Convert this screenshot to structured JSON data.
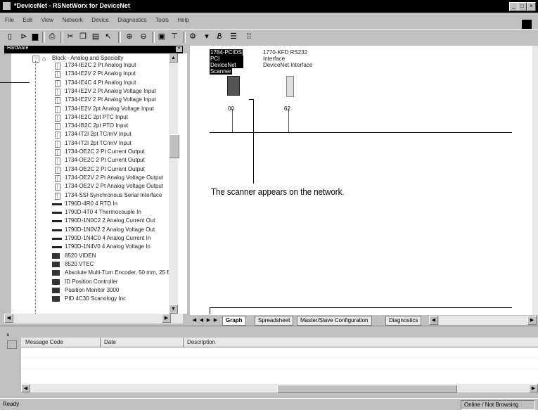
{
  "window": {
    "title": "*DeviceNet - RSNetWorx for DeviceNet"
  },
  "menu": {
    "items": [
      "File",
      "Edit",
      "View",
      "Network",
      "Device",
      "Diagnostics",
      "Tools",
      "Help"
    ]
  },
  "tree": {
    "header": "Hardware",
    "category": "Block - Analog and Specialty",
    "items": [
      "1734-IE2C 2 Pt Analog Input",
      "1734-IE2V 2 Pt Analog Input",
      "1734-IE4C 4 Pt Analog Input",
      "1734-IE2V 2 Pt Analog Voltage Input",
      "1734-IE2V 2 Pt Analog Voltage Input",
      "1734-IE2V 2pt Analog Voltage Input",
      "1734-IE2C 2pt PTC Input",
      "1734-IB2C 2pt PTO Input",
      "1734-IT2I 2pt TC/mV Input",
      "1734-IT2I 2pt TC/mV Input",
      "1734-OE2C 2 Pt Current Output",
      "1734-OE2C 2 Pt Current Output",
      "1734-OE2C 2 Pt Current Output",
      "1734-OE2V 2 Pt Analog Voltage Output",
      "1734-OE2V 2 Pt Analog Voltage Output",
      "1734-SSI Synchronous Serial Interface",
      "1790D-4R0 4 RTD In",
      "1790D-4T0 4 Thermocouple In",
      "1790D-1N0C2 2 Analog Current Out",
      "1790D-1N0V2 2 Analog Voltage Out",
      "1790D-1N4C0 4 Analog Current In",
      "1790D-1N4V0 4 Analog Voltage In",
      "8520 VIDEN",
      "8520 VTEC",
      "Absolute Multi-Turn Encoder, 50 mm, 25 Bit",
      "ID Position Controller",
      "Position Monitor 3000",
      "PID 4C30 Scanology Inc"
    ]
  },
  "graph": {
    "node1": {
      "lines": [
        "1784-PCIDS",
        "PCI DeviceNet",
        "Scanner"
      ],
      "address": "00"
    },
    "node2": {
      "lines": [
        "1770-KFD RS232",
        "Interface",
        "DeviceNet Interface"
      ],
      "address": "62"
    },
    "callout": "The scanner appears on the network."
  },
  "tabs": [
    {
      "label": "Graph"
    },
    {
      "label": "Spreadsheet"
    },
    {
      "label": "Master/Slave Configuration"
    },
    {
      "label": "Diagnostics"
    }
  ],
  "messages": {
    "columns": [
      "Message Code",
      "Date",
      "Description"
    ]
  },
  "status": {
    "left": "Ready",
    "right": "Online / Not Browsing"
  },
  "colors": {
    "titlebar": "#000000",
    "panel": "#c0c0c0"
  }
}
